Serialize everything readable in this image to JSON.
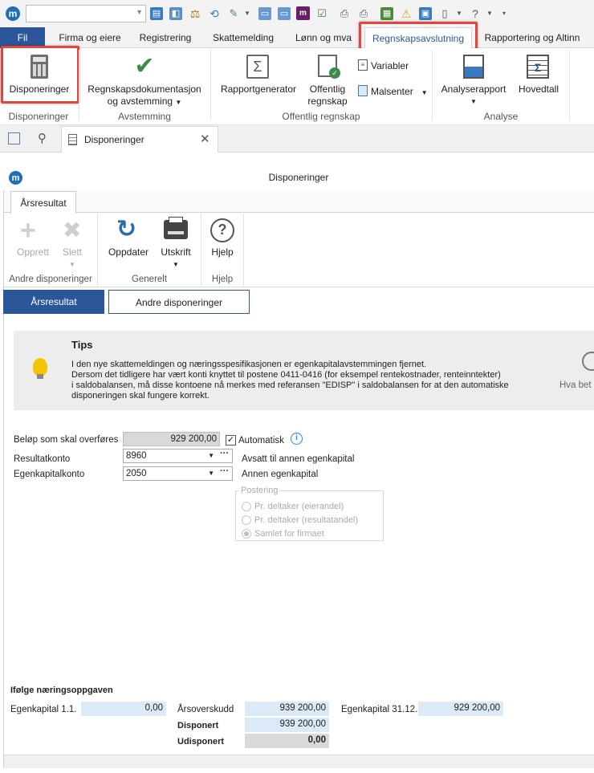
{
  "quick_access": {
    "icons": [
      "home-icon",
      "scales-icon",
      "sync-icon",
      "edit-icon",
      "dropdown-icon",
      "monitor-icon",
      "monitor-icon",
      "logo-icon",
      "checklist-icon",
      "printer-icon",
      "printer-check-icon",
      "table-icon",
      "warning-icon",
      "window-icon",
      "document-icon",
      "help-icon"
    ]
  },
  "ribbon_tabs": [
    "Fil",
    "Firma og eiere",
    "Registrering",
    "Skattemelding",
    "Lønn og mva",
    "Regnskapsavslutning",
    "Rapportering og Altinn"
  ],
  "ribbon": {
    "btn_disponeringer": "Disponeringer",
    "btn_regnskapsdok_1": "Regnskapsdokumentasjon",
    "btn_regnskapsdok_2": "og avstemming",
    "btn_rapportgenerator": "Rapportgenerator",
    "btn_offentlig_1": "Offentlig",
    "btn_offentlig_2": "regnskap",
    "btn_variabler": "Variabler",
    "btn_malsenter": "Malsenter",
    "btn_analyserapport": "Analyserapport",
    "btn_hovedtall": "Hovedtall",
    "group_disponeringer": "Disponeringer",
    "group_avstemming": "Avstemming",
    "group_offentlig": "Offentlig regnskap",
    "group_analyse": "Analyse"
  },
  "doc_tab": {
    "label": "Disponeringer"
  },
  "window": {
    "title": "Disponeringer",
    "inner_tab": "Årsresultat",
    "toolbar": {
      "opprett": "Opprett",
      "slett": "Slett",
      "oppdater": "Oppdater",
      "utskrift": "Utskrift",
      "hjelp": "Hjelp",
      "group_andre": "Andre disponeringer",
      "group_generelt": "Generelt",
      "group_hjelp": "Hjelp"
    },
    "subtabs": [
      "Årsresultat",
      "Andre disponeringer"
    ]
  },
  "tips": {
    "title": "Tips",
    "line1": "I den nye skattemeldingen og næringsspesifikasjonen er egenkapitalavstemmingen fjernet.",
    "line2": "Dersom det tidligere har vært konti knyttet til postene 0411-0416 (for eksempel rentekostnader, renteinntekter)",
    "line3": "i saldobalansen, må disse kontoene nå merkes med referansen \"EDISP\" i saldobalansen for at den automatiske",
    "line4": "disponeringen skal fungere korrekt.",
    "side_label": "Hva bet"
  },
  "form": {
    "belop_label": "Beløp som skal overføres",
    "belop_value": "929 200,00",
    "automatisk_label": "Automatisk",
    "automatisk_checked": true,
    "resultatkonto_label": "Resultatkonto",
    "resultatkonto_value": "8960",
    "resultatkonto_desc": "Avsatt til annen egenkapital",
    "egenkapitalkonto_label": "Egenkapitalkonto",
    "egenkapitalkonto_value": "2050",
    "egenkapitalkonto_desc": "Annen egenkapital",
    "postering_label": "Postering",
    "postering_options": [
      "Pr. deltaker (eierandel)",
      "Pr. deltaker (resultatandel)",
      "Samlet for firmaet"
    ],
    "postering_selected": "Samlet for firmaet"
  },
  "summary": {
    "heading": "Ifølge næringsoppgaven",
    "ek11_label": "Egenkapital 1.1.",
    "ek11_value": "0,00",
    "arsoverskudd_label": "Årsoverskudd",
    "arsoverskudd_value": "939 200,00",
    "disponert_label": "Disponert",
    "disponert_value": "939 200,00",
    "udisponert_label": "Udisponert",
    "udisponert_value": "0,00",
    "ek3112_label": "Egenkapital 31.12.",
    "ek3112_value": "929 200,00"
  },
  "colors": {
    "brand_blue": "#2b579a",
    "highlight_red": "#e0463c",
    "field_blue": "#dce9f7"
  }
}
